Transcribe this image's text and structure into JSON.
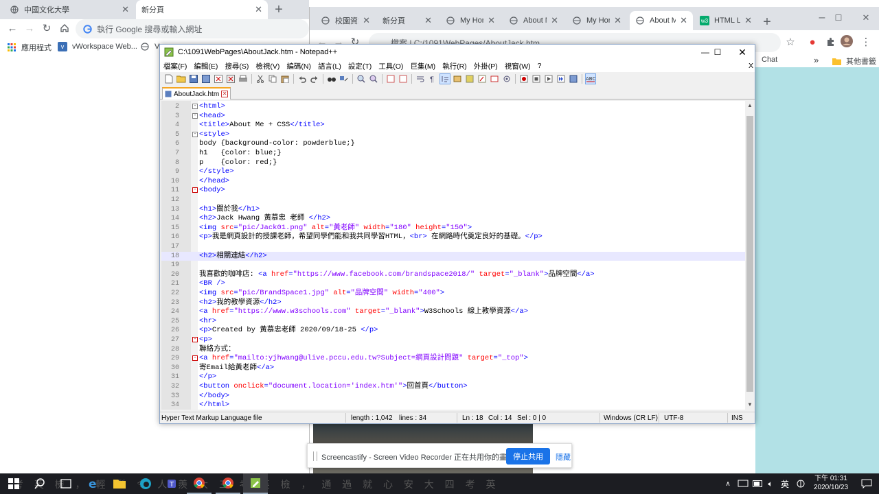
{
  "chrome1": {
    "tabs": [
      {
        "title": "中國文化大學"
      },
      {
        "title": "新分頁"
      }
    ],
    "omnibox_placeholder": "執行 Google 搜尋或輸入網址",
    "bookmarks": [
      {
        "label": "應用程式"
      },
      {
        "label": "vWorkspace Web..."
      },
      {
        "label": "V"
      }
    ]
  },
  "chrome2": {
    "tabs": [
      {
        "title": "校園資訊"
      },
      {
        "title": "新分頁"
      },
      {
        "title": "My Hom"
      },
      {
        "title": "About M"
      },
      {
        "title": "My Hom"
      },
      {
        "title": "About M"
      },
      {
        "title": "HTML Li"
      }
    ],
    "address": "檔案 | C:/1091WebPages/AboutJack.htm",
    "bookmarks": [
      {
        "label": "Chat"
      },
      {
        "label": "»"
      },
      {
        "label": "其他書籤"
      }
    ]
  },
  "notepad": {
    "title": "C:\\1091WebPages\\AboutJack.htm - Notepad++",
    "menus": [
      "檔案(F)",
      "編輯(E)",
      "搜尋(S)",
      "檢視(V)",
      "編碼(N)",
      "語言(L)",
      "設定(T)",
      "工具(O)",
      "巨集(M)",
      "執行(R)",
      "外掛(P)",
      "視窗(W)",
      "?"
    ],
    "close_x": "X",
    "doc_tab": "AboutJack.htm",
    "lines": [
      {
        "n": "2",
        "fold": "-",
        "html": "<span class=t>&lt;html&gt;</span>"
      },
      {
        "n": "3",
        "fold": "-",
        "html": "<span class=t>&lt;head&gt;</span>"
      },
      {
        "n": "4",
        "fold": "",
        "html": "<span class=t>&lt;title&gt;</span>About Me + CSS<span class=t>&lt;/title&gt;</span>"
      },
      {
        "n": "5",
        "fold": "-",
        "html": "<span class=t>&lt;style&gt;</span>"
      },
      {
        "n": "6",
        "fold": "",
        "html": "body {background-color: powderblue;}"
      },
      {
        "n": "7",
        "fold": "",
        "html": "h1   {color: blue;}"
      },
      {
        "n": "8",
        "fold": "",
        "html": "p    {color: red;}"
      },
      {
        "n": "9",
        "fold": "",
        "html": "<span class=t>&lt;/style&gt;</span>"
      },
      {
        "n": "10",
        "fold": "",
        "html": "<span class=t>&lt;/head&gt;</span>"
      },
      {
        "n": "11",
        "fold": "red",
        "html": "<span class=t>&lt;body&gt;</span>"
      },
      {
        "n": "12",
        "fold": "",
        "html": ""
      },
      {
        "n": "13",
        "fold": "",
        "html": "<span class=t>&lt;h1&gt;</span>關於我<span class=t>&lt;/h1&gt;</span>"
      },
      {
        "n": "14",
        "fold": "",
        "html": "<span class=t>&lt;h2&gt;</span>Jack Hwang 黃慕忠 老師 <span class=t>&lt;/h2&gt;</span>"
      },
      {
        "n": "15",
        "fold": "",
        "html": "<span class=t>&lt;img </span><span class=a>src</span><span class=t>=</span><span class=v>\"pic/Jack01.png\"</span><span class=t> </span><span class=a>alt</span><span class=t>=</span><span class=v>\"黃老師\"</span><span class=t> </span><span class=a>width</span><span class=t>=</span><span class=v>\"180\"</span><span class=t> </span><span class=a>height</span><span class=t>=</span><span class=v>\"150\"</span><span class=t>&gt;</span>"
      },
      {
        "n": "16",
        "fold": "",
        "html": "<span class=t>&lt;p&gt;</span>我是網頁設計的授課老師，希望同學們能和我共同學習HTML，<span class=t>&lt;br&gt;</span> 在網路時代奠定良好的基礎。<span class=t>&lt;/p&gt;</span>"
      },
      {
        "n": "17",
        "fold": "",
        "html": ""
      },
      {
        "n": "18",
        "fold": "",
        "html": "<span class=t>&lt;h2&gt;</span>相關連結<span class=t>&lt;/h2&gt;</span>",
        "current": true
      },
      {
        "n": "19",
        "fold": "",
        "html": ""
      },
      {
        "n": "20",
        "fold": "",
        "html": "我喜歡的咖啡店: <span class=t>&lt;a </span><span class=a>href</span><span class=t>=</span><span class=v>\"https://www.facebook.com/brandspace2018/\"</span><span class=t> </span><span class=a>target</span><span class=t>=</span><span class=v>\"_blank\"</span><span class=t>&gt;</span>品牌空間<span class=t>&lt;/a&gt;</span>"
      },
      {
        "n": "21",
        "fold": "",
        "html": "<span class=t>&lt;BR /&gt;</span>"
      },
      {
        "n": "22",
        "fold": "",
        "html": "<span class=t>&lt;img </span><span class=a>src</span><span class=t>=</span><span class=v>\"pic/BrandSpace1.jpg\"</span><span class=t> </span><span class=a>alt</span><span class=t>=</span><span class=v>\"品牌空間\"</span><span class=t> </span><span class=a>width</span><span class=t>=</span><span class=v>\"400\"</span><span class=t>&gt;</span>"
      },
      {
        "n": "23",
        "fold": "",
        "html": "<span class=t>&lt;h2&gt;</span>我的教學資源<span class=t>&lt;/h2&gt;</span>"
      },
      {
        "n": "24",
        "fold": "",
        "html": "<span class=t>&lt;a </span><span class=a>href</span><span class=t>=</span><span class=v>\"https://www.w3schools.com\"</span><span class=t> </span><span class=a>target</span><span class=t>=</span><span class=v>\"_blank\"</span><span class=t>&gt;</span>W3Schools 線上教學資源<span class=t>&lt;/a&gt;</span>"
      },
      {
        "n": "25",
        "fold": "",
        "html": "<span class=t>&lt;hr&gt;</span>"
      },
      {
        "n": "26",
        "fold": "",
        "html": "<span class=t>&lt;p&gt;</span>Created by 黃慕忠老師 2020/09/18-25 <span class=t>&lt;/p&gt;</span>"
      },
      {
        "n": "27",
        "fold": "red",
        "html": "<span class=t>&lt;p&gt;</span>"
      },
      {
        "n": "28",
        "fold": "",
        "html": "聯絡方式："
      },
      {
        "n": "29",
        "fold": "red",
        "html": "<span class=t>&lt;a </span><span class=a>href</span><span class=t>=</span><span class=v>\"mailto:yjhwang@ulive.pccu.edu.tw?Subject=網頁設計問題\"</span><span class=t> </span><span class=a>target</span><span class=t>=</span><span class=v>\"_top\"</span><span class=t>&gt;</span>"
      },
      {
        "n": "30",
        "fold": "",
        "html": "寄Email給黃老師<span class=t>&lt;/a&gt;</span>"
      },
      {
        "n": "31",
        "fold": "",
        "html": "<span class=t>&lt;/p&gt;</span>"
      },
      {
        "n": "32",
        "fold": "",
        "html": "<span class=t>&lt;button </span><span class=a>onclick</span><span class=t>=</span><span class=v>\"document.location='index.htm'\"</span><span class=t>&gt;</span>回首頁<span class=t>&lt;/button&gt;</span>"
      },
      {
        "n": "33",
        "fold": "",
        "html": "<span class=t>&lt;/body&gt;</span>"
      },
      {
        "n": "34",
        "fold": "",
        "html": "<span class=t>&lt;/html&gt;</span>"
      }
    ],
    "status": {
      "filetype": "Hyper Text Markup Language file",
      "length": "length : 1,042",
      "lines": "lines : 34",
      "ln": "Ln : 18",
      "col": "Col : 14",
      "sel": "Sel : 0 | 0",
      "eol": "Windows (CR LF)",
      "encoding": "UTF-8",
      "mode": "INS"
    }
  },
  "notification": {
    "text": "Screencastify - Screen Video Recorder 正在共用你的畫面。",
    "stop_label": "停止共用",
    "hide_label": "隱藏"
  },
  "taskbar": {
    "ime": "英",
    "time": "下午 01:31",
    "date": "2020/10/23",
    "subtitle": "考 英 檢 ， 輕 鬆 令 人 羨    大 三 考 英 檢 ， 通 過 就 心 安    大 四 考 英"
  }
}
